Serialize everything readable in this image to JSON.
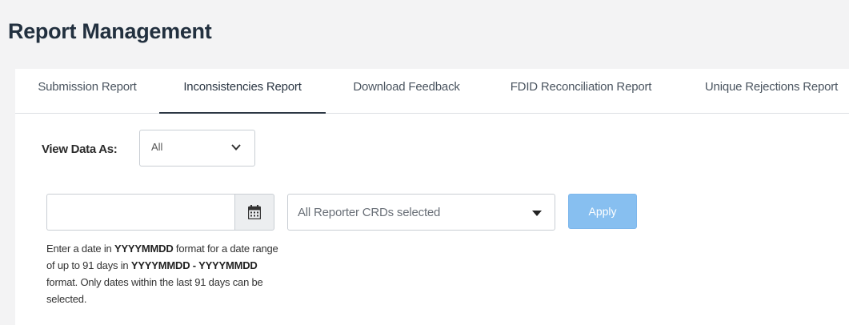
{
  "page": {
    "title": "Report Management"
  },
  "tabs": [
    {
      "label": "Submission Report",
      "active": false
    },
    {
      "label": "Inconsistencies Report",
      "active": true
    },
    {
      "label": "Download Feedback",
      "active": false
    },
    {
      "label": "FDID Reconciliation Report",
      "active": false
    },
    {
      "label": "Unique Rejections Report",
      "active": false
    }
  ],
  "view_data": {
    "label": "View Data As:",
    "selected": "All"
  },
  "date_filter": {
    "value": "",
    "help": {
      "t1": "Enter a date in ",
      "b1": "YYYYMMDD",
      "t2": " format for a date range of up to 91 days in ",
      "b2": "YYYYMMDD - YYYYMMDD",
      "t3": " format. Only dates within the last 91 days can be selected."
    },
    "icon": "calendar-icon"
  },
  "reporter_select": {
    "selected": "All Reporter CRDs selected",
    "icon": "caret-down-icon"
  },
  "apply_button": {
    "label": "Apply",
    "disabled": true
  },
  "colors": {
    "header_bg": "#f3f3f4",
    "title": "#22303f",
    "active_tab_underline": "#2c3744",
    "apply_bg": "#87bff0"
  }
}
